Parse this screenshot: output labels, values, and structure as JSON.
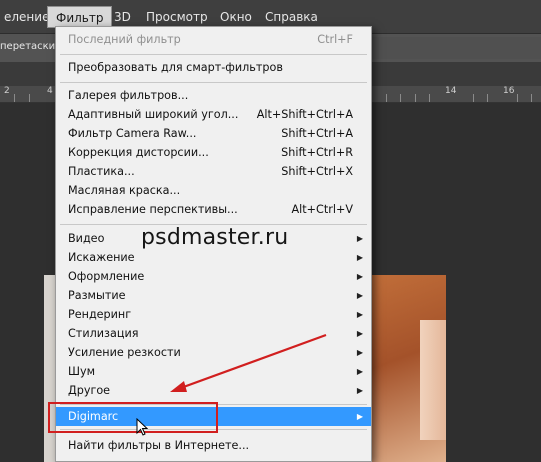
{
  "menubar": {
    "items": [
      {
        "label": "еление"
      },
      {
        "label": "Фильтр"
      },
      {
        "label": "3D"
      },
      {
        "label": "Просмотр"
      },
      {
        "label": "Окно"
      },
      {
        "label": "Справка"
      }
    ]
  },
  "options_bar": {
    "text": "перетаски"
  },
  "ruler": {
    "ticks": [
      "2",
      "4",
      "14",
      "16"
    ]
  },
  "filter_menu": {
    "last_filter": {
      "label": "Последний фильтр",
      "shortcut": "Ctrl+F"
    },
    "convert_smart": {
      "label": "Преобразовать для смарт-фильтров"
    },
    "group1": [
      {
        "label": "Галерея фильтров...",
        "shortcut": ""
      },
      {
        "label": "Адаптивный широкий угол...",
        "shortcut": "Alt+Shift+Ctrl+A"
      },
      {
        "label": "Фильтр Camera Raw...",
        "shortcut": "Shift+Ctrl+A"
      },
      {
        "label": "Коррекция дисторсии...",
        "shortcut": "Shift+Ctrl+R"
      },
      {
        "label": "Пластика...",
        "shortcut": "Shift+Ctrl+X"
      },
      {
        "label": "Масляная краска...",
        "shortcut": ""
      },
      {
        "label": "Исправление перспективы...",
        "shortcut": "Alt+Ctrl+V"
      }
    ],
    "submenus": [
      {
        "label": "Видео"
      },
      {
        "label": "Искажение"
      },
      {
        "label": "Оформление"
      },
      {
        "label": "Размытие"
      },
      {
        "label": "Рендеринг"
      },
      {
        "label": "Стилизация"
      },
      {
        "label": "Усиление резкости"
      },
      {
        "label": "Шум"
      },
      {
        "label": "Другое"
      }
    ],
    "digimarc": {
      "label": "Digimarc"
    },
    "browse_online": {
      "label": "Найти фильтры в Интернете..."
    }
  },
  "watermark": "psdmaster.ru",
  "colors": {
    "highlight": "#3399ff",
    "annotation": "#d11f1f"
  },
  "icons": {
    "submenu_arrow": "triangle-right-icon",
    "cursor": "mouse-pointer-icon"
  }
}
